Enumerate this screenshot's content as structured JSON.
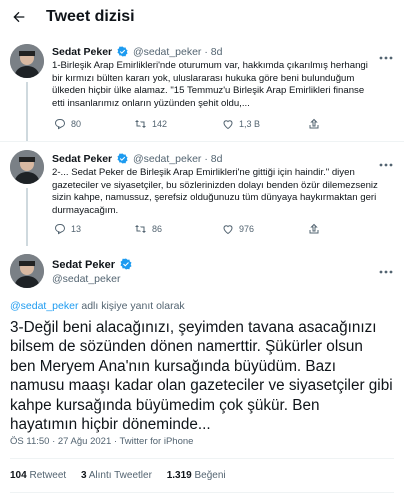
{
  "header": {
    "title": "Tweet dizisi"
  },
  "author": {
    "name": "Sedat Peker",
    "handle": "@sedat_peker"
  },
  "tweets": [
    {
      "time": "8d",
      "lines": [
        "1-Birleşik Arap Emirlikleri'nde oturumum var, hakkımda çıkarılmış herhangi",
        "bir kırmızı bülten kararı yok, uluslararası hukuka göre beni bulunduğum",
        "ülkeden hiçbir ülke alamaz. \"15 Temmuz'u Birleşik Arap Emirlikleri finanse",
        "etti insanlarımız onların yüzünden şehit oldu,..."
      ],
      "replies": "80",
      "retweets": "142",
      "likes": "1,3 B"
    },
    {
      "time": "8d",
      "lines": [
        "2-... Sedat Peker de Birleşik Arap Emirlikleri'ne gittiği için haindir.\" diyen",
        "gazeteciler ve siyasetçiler, bu sözlerinizden dolayı benden özür dilemezseniz",
        "sizin kahpe, namussuz, şerefsiz olduğunuzu tüm dünyaya haykırmaktan geri",
        "durmayacağım."
      ],
      "replies": "13",
      "retweets": "86",
      "likes": "976"
    }
  ],
  "main": {
    "replying_handle": "@sedat_peker",
    "replying_suffix": " adlı kişiye yanıt olarak",
    "lines": [
      "3-Değil beni alacağınızı, şeyimden tavana asacağınızı",
      "bilsem de sözünden dönen namerttir. Şükürler olsun",
      "ben Meryem Ana'nın kursağında büyüdüm. Bazı",
      "namusu maaşı kadar olan gazeteciler ve siyasetçiler gibi",
      "kahpe kursağında büyümedim çok şükür. Ben",
      "hayatımın hiçbir döneminde..."
    ],
    "meta": "ÖS 11:50 · 27 Ağu 2021 · Twitter for iPhone",
    "stats": {
      "retweets_count": "104",
      "retweets_label": "Retweet",
      "quotes_count": "3",
      "quotes_label": "Alıntı Tweetler",
      "likes_count": "1.319",
      "likes_label": "Beğeni"
    }
  },
  "colors": {
    "accent": "#1d9bf0",
    "text": "#0f1419",
    "muted": "#536471",
    "divider": "#eff3f4"
  }
}
